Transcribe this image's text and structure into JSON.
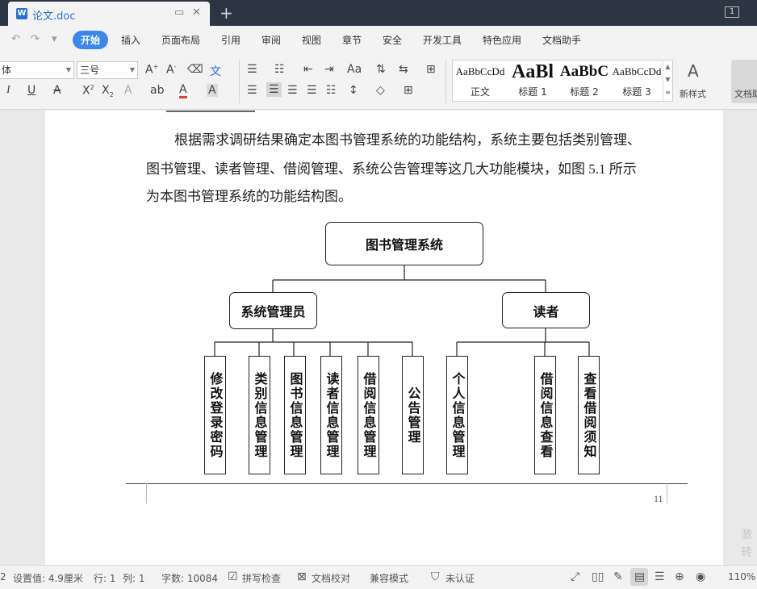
{
  "tab": {
    "title": "论文.doc",
    "word_icon": "W",
    "restore_icon": "▭",
    "close_icon": "✕"
  },
  "titlebar": {
    "new_tab": "+",
    "window_count": "1"
  },
  "quick_access": [
    "↶",
    "↷",
    "▾"
  ],
  "menu": [
    {
      "label": "开始",
      "active": true
    },
    {
      "label": "插入"
    },
    {
      "label": "页面布局"
    },
    {
      "label": "引用"
    },
    {
      "label": "审阅"
    },
    {
      "label": "视图"
    },
    {
      "label": "章节"
    },
    {
      "label": "安全"
    },
    {
      "label": "开发工具"
    },
    {
      "label": "特色应用"
    },
    {
      "label": "文档助手"
    }
  ],
  "ribbon": {
    "font_name": "体",
    "font_size": "三号",
    "styles": [
      {
        "sample": "AaBbCcDd",
        "name": "正文",
        "size": 13,
        "bold": false
      },
      {
        "sample": "AaBl",
        "name": "标题 1",
        "size": 24,
        "bold": true
      },
      {
        "sample": "AaBbC",
        "name": "标题 2",
        "size": 19,
        "bold": true
      },
      {
        "sample": "AaBbCcDd",
        "name": "标题 3",
        "size": 13,
        "bold": false
      }
    ],
    "new_style_label": "新样式",
    "doc_helper_label": "文档助"
  },
  "document": {
    "paragraph_lines": [
      "根据需求调研结果确定本图书管理系统的功能结构，系统主要包括类别管理、",
      "图书管理、读者管理、借阅管理、系统公告管理等这几大功能模块，如图 5.1 所示",
      "为本图书管理系统的功能结构图。"
    ],
    "page_number": "11",
    "watermark_lines": [
      "激",
      "转"
    ]
  },
  "diagram": {
    "root": "图书管理系统",
    "groups": [
      {
        "label": "系统管理员",
        "children": [
          "修改登录密码",
          "类别信息管理",
          "图书信息管理",
          "读者信息管理",
          "借阅信息管理",
          "公告管理"
        ]
      },
      {
        "label": "读者",
        "children": [
          "个人信息管理",
          "借阅信息查看",
          "查看借阅须知"
        ]
      }
    ]
  },
  "status": {
    "page_info": "2",
    "position": "设置值: 4.9厘米",
    "row": "行: 1",
    "col": "列: 1",
    "word_count": "字数: 10084",
    "spell_check": "拼写检查",
    "proofread": "文档校对",
    "compat_mode": "兼容模式",
    "auth": "未认证",
    "zoom": "110%"
  }
}
